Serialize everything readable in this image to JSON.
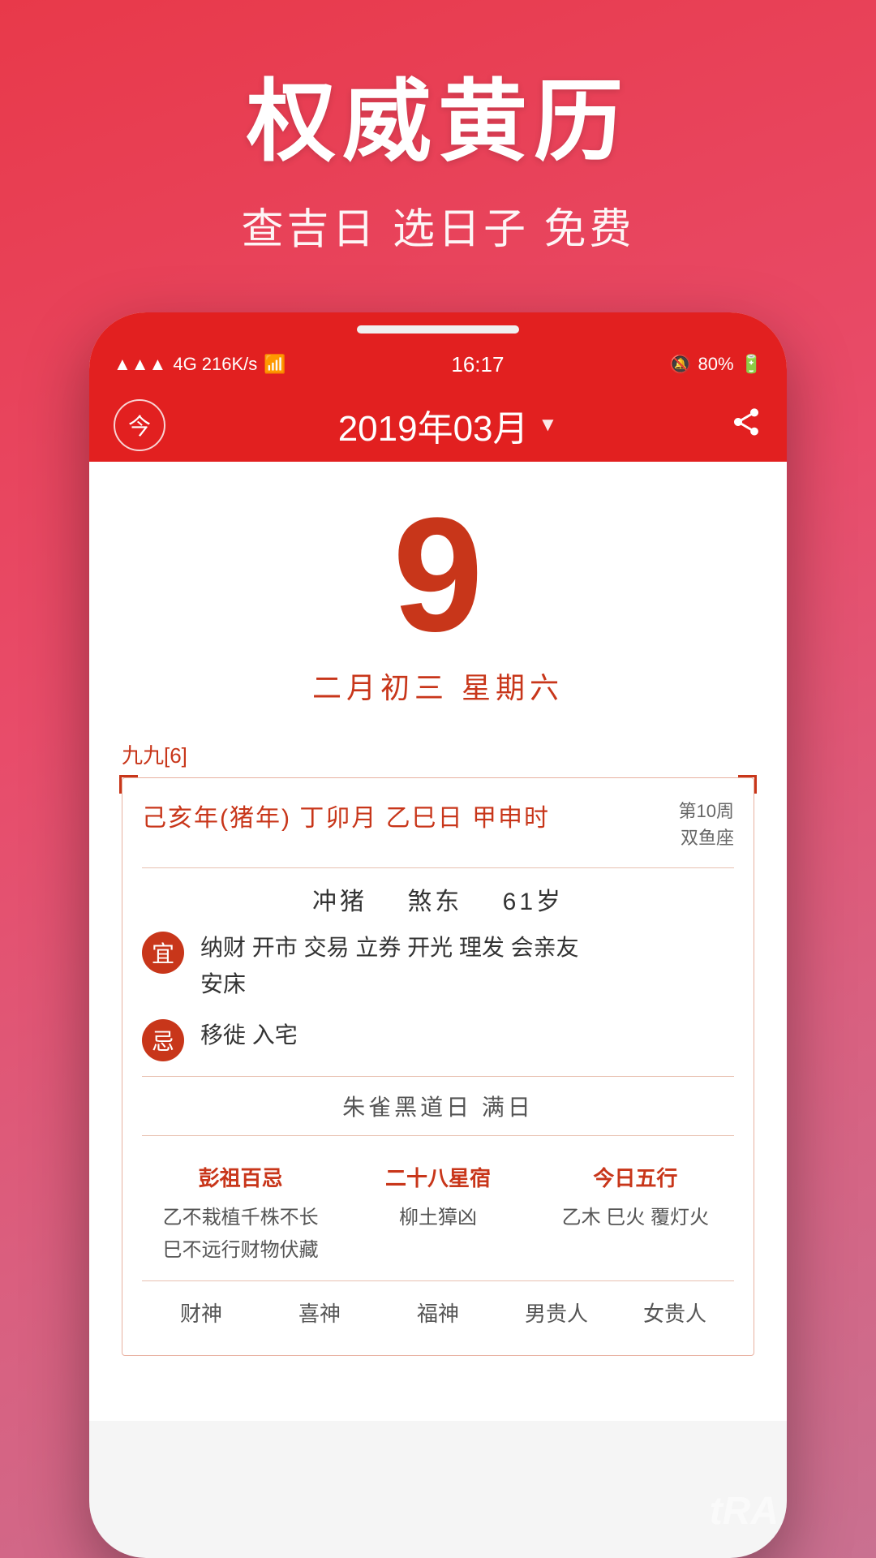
{
  "app": {
    "main_title": "权威黄历",
    "sub_title": "查吉日 选日子 免费"
  },
  "status_bar": {
    "signal": "4G 216K/s",
    "wifi": "WiFi",
    "time": "16:17",
    "alarm": "🔕",
    "battery": "80%"
  },
  "header": {
    "today_label": "今",
    "month_title": "2019年03月",
    "dropdown": "▼",
    "share_icon": "⬆"
  },
  "date": {
    "day_number": "9",
    "lunar_date": "二月初三",
    "weekday": "星期六"
  },
  "calendar_info": {
    "jiu_label": "九九[6]",
    "ganzhi": "己亥年(猪年) 丁卯月 乙巳日 甲申时",
    "week_num": "第10周",
    "zodiac": "双鱼座",
    "chong": "冲猪",
    "sha": "煞东",
    "age": "61岁",
    "yi_label": "宜",
    "yi_content": "纳财 开市 交易 立券 开光 理发 会亲友\n安床",
    "ji_label": "忌",
    "ji_content": "移徙 入宅",
    "black_day": "朱雀黑道日  满日",
    "col1_title": "彭祖百忌",
    "col1_line1": "乙不栽植千株不长",
    "col1_line2": "巳不远行财物伏藏",
    "col2_title": "二十八星宿",
    "col2_content": "柳土獐凶",
    "col3_title": "今日五行",
    "col3_content": "乙木 巳火 覆灯火",
    "footer_items": [
      "财神",
      "喜神",
      "福神",
      "男贵人",
      "女贵人"
    ]
  },
  "brand": "tRA"
}
